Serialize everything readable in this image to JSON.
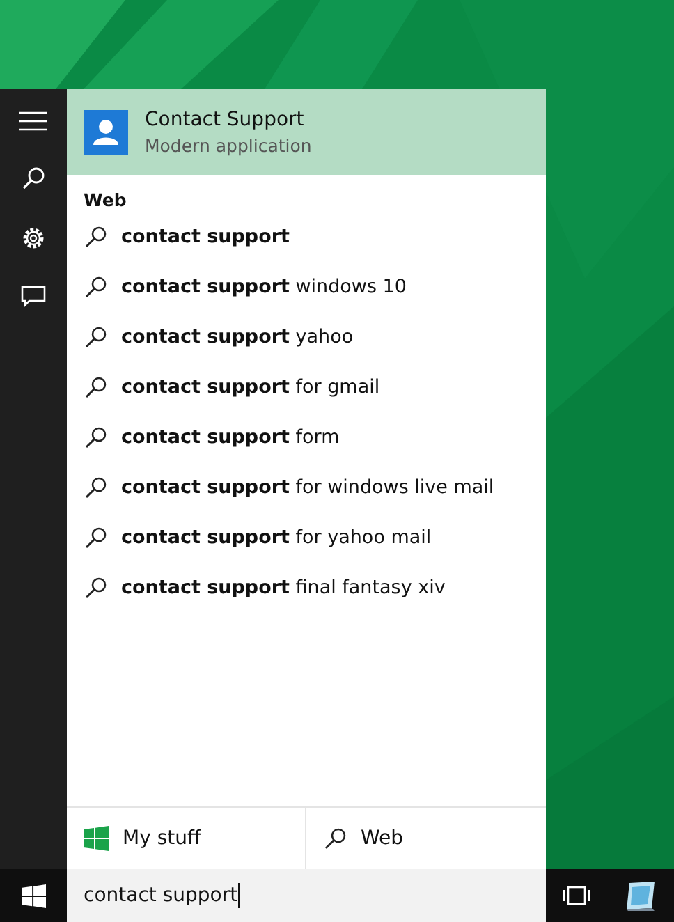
{
  "app_result": {
    "title": "Contact Support",
    "subtitle": "Modern application",
    "selected": true
  },
  "section_label": "Web",
  "suggestions": [
    {
      "text": "**contact support**"
    },
    {
      "text": "**contact support** windows 10"
    },
    {
      "text": "**contact support** yahoo"
    },
    {
      "text": "**contact support** for gmail"
    },
    {
      "text": "**contact support** form"
    },
    {
      "text": "**contact support** for windows live mail"
    },
    {
      "text": "**contact support** for yahoo mail"
    },
    {
      "text": "**contact support** final fantasy xiv"
    }
  ],
  "scope_tabs": [
    {
      "label": "My stuff",
      "kind": "windows"
    },
    {
      "label": "Web",
      "kind": "search"
    }
  ],
  "search_box": {
    "value": "contact support"
  }
}
